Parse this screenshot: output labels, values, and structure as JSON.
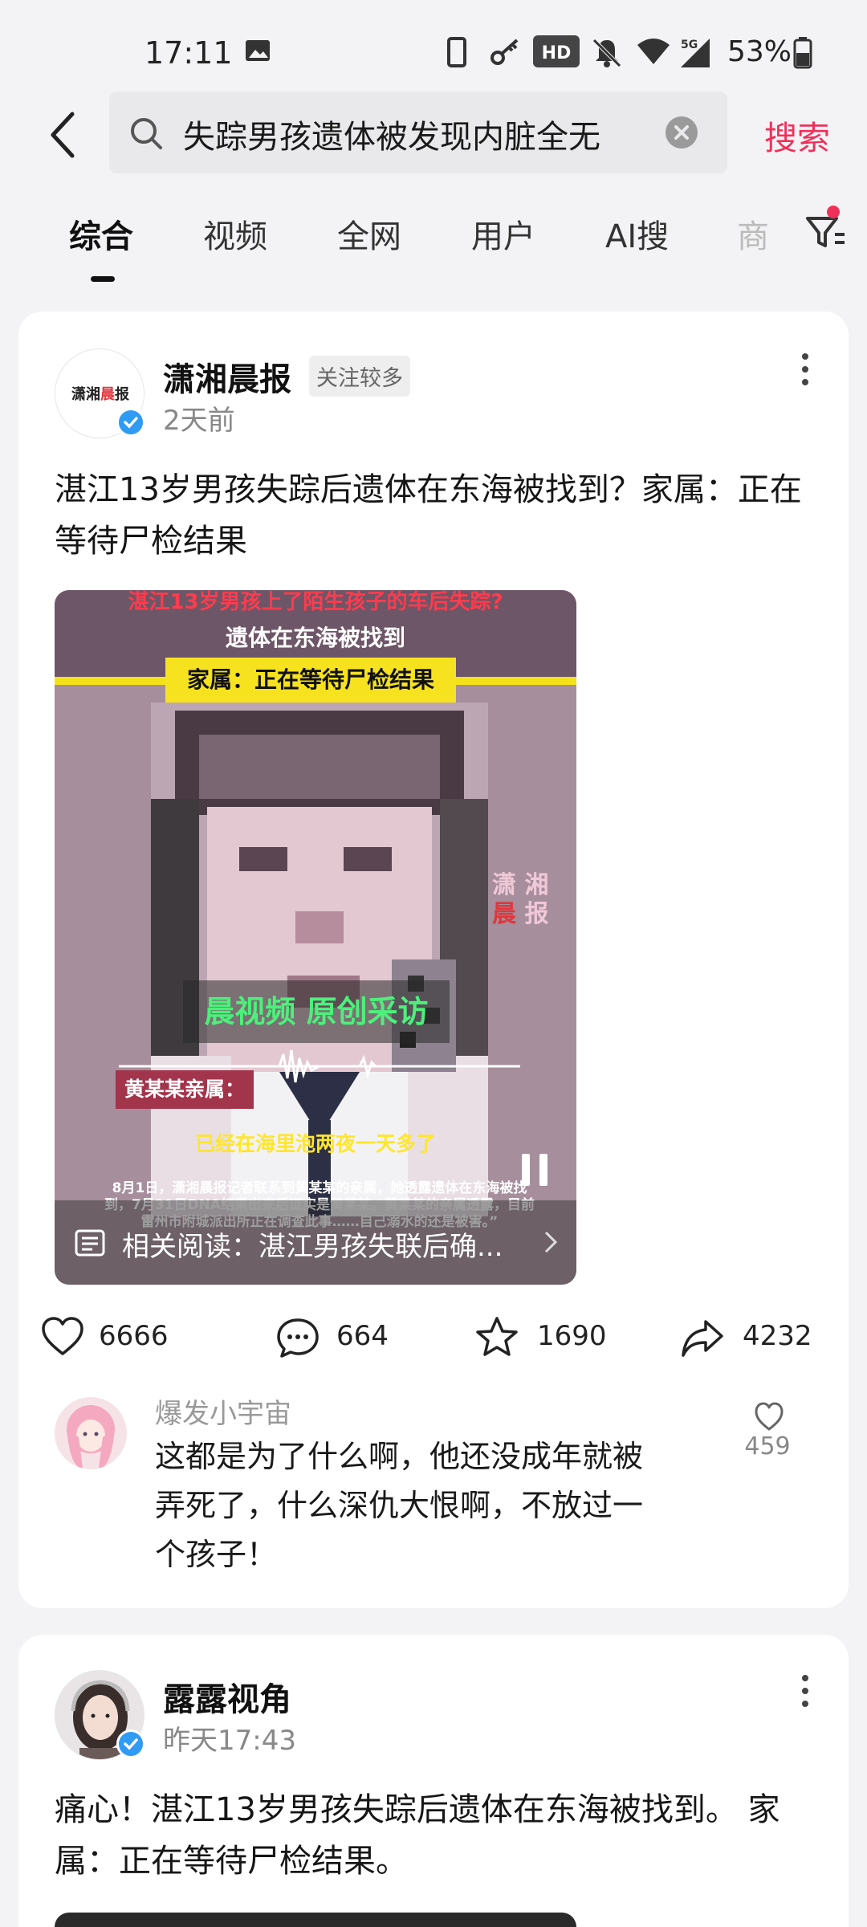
{
  "status_bar": {
    "time": "17:11",
    "battery_percent": "53%",
    "hd_label": "HD",
    "network_label": "5G"
  },
  "header": {
    "search_query": "失踪男孩遗体被发现内脏全无",
    "search_button": "搜索"
  },
  "tabs": [
    {
      "label": "综合",
      "active": true
    },
    {
      "label": "视频"
    },
    {
      "label": "全网"
    },
    {
      "label": "用户"
    },
    {
      "label": "AI搜"
    },
    {
      "label": "商"
    }
  ],
  "posts": [
    {
      "author": "潇湘晨报",
      "avatar_text": "潇湘晨报",
      "follow_tag": "关注较多",
      "time": "2天前",
      "text": "湛江13岁男孩失踪后遗体在东海被找到？家属：正在等待尸检结果",
      "video": {
        "caption_red": "湛江13岁男孩上了陌生孩子的车后失踪?",
        "caption_white": "遗体在东海被找到",
        "caption_yellow": "家属：正在等待尸检结果",
        "logo_1": "潇 湘",
        "logo_2": "晨",
        "logo_3": "报",
        "green_title": "晨视频 原创采访",
        "speaker": "黄某某亲属：",
        "subtitle": "已经在海里泡两夜一天多了",
        "small_text": "8月1日，潇湘晨报记者联系到黄某某的亲属，她透露遗体在东海被找到，7月31日DNA结果出来后证实是黄某某。黄某某的亲属透露，目前雷州市附城派出所正在调查此事……自己溺水的还是被害。”",
        "related": "相关阅读：湛江男孩失联后确..."
      },
      "actions": {
        "likes": "6666",
        "comments": "664",
        "favorites": "1690",
        "shares": "4232"
      },
      "top_comment": {
        "user": "爆发小宇宙",
        "text": "这都是为了什么啊，他还没成年就被弄死了，什么深仇大恨啊，不放过一个孩子！",
        "likes": "459"
      }
    },
    {
      "author": "露露视角",
      "time": "昨天17:43",
      "text": "痛心！湛江13岁男孩失踪后遗体在东海被找到。 家属：正在等待尸检结果。"
    }
  ]
}
